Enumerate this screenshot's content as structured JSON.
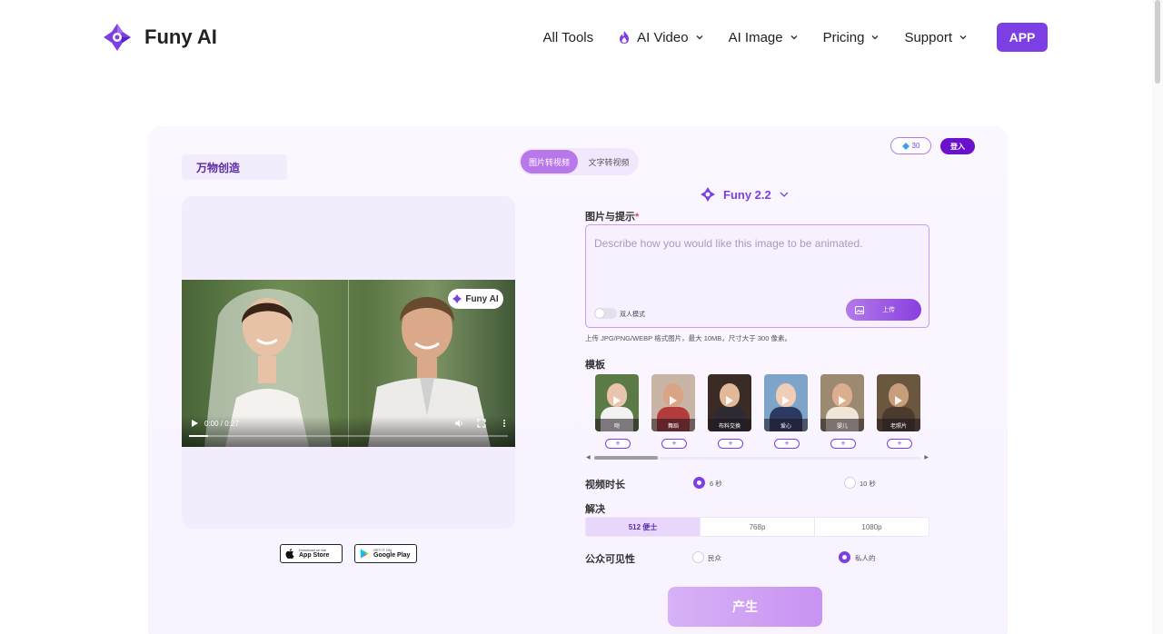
{
  "header": {
    "brand": "Funy AI",
    "nav": [
      {
        "label": "All Tools"
      },
      {
        "label": "AI Video"
      },
      {
        "label": "AI Image"
      },
      {
        "label": "Pricing"
      },
      {
        "label": "Support"
      }
    ],
    "app_button": "APP"
  },
  "card": {
    "creator_tab": "万物创造",
    "modes": [
      "图片转视频",
      "文字转视频"
    ],
    "credits": "30",
    "login": "登入"
  },
  "preview": {
    "badge": "Funy AI",
    "time": "0:00 / 0:27",
    "progress": 0.06,
    "stores": [
      {
        "small": "Download on the",
        "big": "App Store"
      },
      {
        "small": "GET IT ON",
        "big": "Google Play"
      }
    ]
  },
  "form": {
    "model": "Funy 2.2",
    "image_prompt_label": "图片与提示",
    "required_mark": "*",
    "prompt_placeholder": "Describe how you would like this image to be animated.",
    "dual_mode_label": "双人模式",
    "upload_label": "上传",
    "upload_hint": "上传 JPG/PNG/WEBP 格式图片，最大 10MB，尺寸大于 300 像素。",
    "templates_label": "模板",
    "templates": [
      {
        "caption": "吻",
        "skin": "#e9c5ad",
        "outfit": "#f2f2f2",
        "bg": "#5c7a46"
      },
      {
        "caption": "舞蹈",
        "skin": "#d9a486",
        "outfit": "#b23b3b",
        "bg": "#c9b5a5"
      },
      {
        "caption": "布料交换",
        "skin": "#e1b89a",
        "outfit": "#2e2a33",
        "bg": "#3a2c25"
      },
      {
        "caption": "爱心",
        "skin": "#efcdb6",
        "outfit": "#2d3a63",
        "bg": "#7ea4c9"
      },
      {
        "caption": "婴儿",
        "skin": "#dcae90",
        "outfit": "#efe6d8",
        "bg": "#9c8a70"
      },
      {
        "caption": "老照片",
        "skin": "#c89d7a",
        "outfit": "#4a3b2e",
        "bg": "#6b5640"
      }
    ],
    "plus_symbol": "+",
    "duration_label": "视频时长",
    "durations": [
      {
        "label": "6 秒",
        "selected": true
      },
      {
        "label": "10 秒",
        "selected": false
      }
    ],
    "resolution_label": "解决",
    "resolutions": [
      {
        "label": "512 便士",
        "selected": true
      },
      {
        "label": "768p",
        "selected": false
      },
      {
        "label": "1080p",
        "selected": false
      }
    ],
    "visibility_label": "公众可见性",
    "visibility": [
      {
        "label": "民众",
        "selected": false
      },
      {
        "label": "私人的",
        "selected": true
      }
    ],
    "generate": "产生"
  },
  "colors": {
    "accent": "#7b3fe4",
    "accent_light": "#b978ea",
    "card_bg": "#fbf7ff"
  }
}
